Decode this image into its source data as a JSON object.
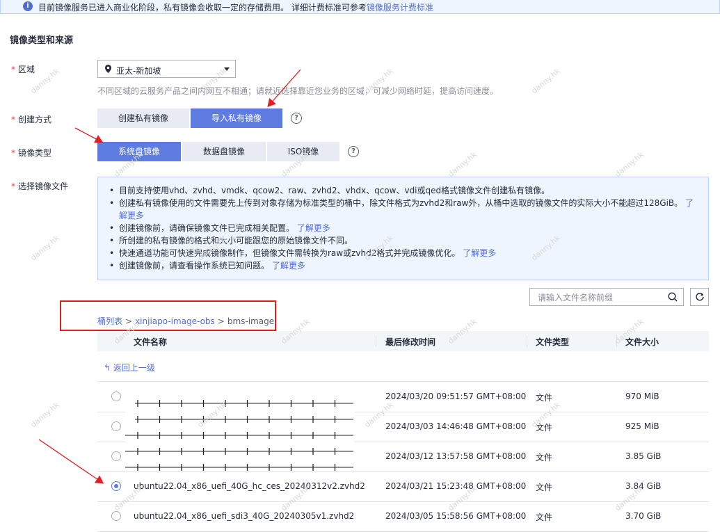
{
  "banner": {
    "text": "目前镜像服务已进入商业化阶段，私有镜像会收取一定的存储费用。 详细计费标准可参考",
    "link": "镜像服务计费标准"
  },
  "section_title": "镜像类型和来源",
  "region": {
    "label": "区域",
    "value": "亚太-新加坡",
    "hint": "不同区域的云服务产品之间内网互不相通；请就近选择靠近您业务的区域，可减少网络时延，提高访问速度。"
  },
  "create_method": {
    "label": "创建方式",
    "options": [
      "创建私有镜像",
      "导入私有镜像"
    ],
    "selected": "导入私有镜像"
  },
  "image_type": {
    "label": "镜像类型",
    "options": [
      "系统盘镜像",
      "数据盘镜像",
      "ISO镜像"
    ],
    "selected": "系统盘镜像"
  },
  "select_file": {
    "label": "选择镜像文件"
  },
  "notice": {
    "items": [
      {
        "text": "目前支持使用vhd、zvhd、vmdk、qcow2、raw、zvhd2、vhdx、qcow、vdi或qed格式镜像文件创建私有镜像。",
        "link": ""
      },
      {
        "text": "创建私有镜像使用的文件需要先上传到对象存储为标准类型的桶中，除文件格式为zvhd2和raw外，从桶中选取的镜像文件的实际大小不能超过128GiB。",
        "link": "了解更多"
      },
      {
        "text": "创建镜像前，请确保镜像文件已完成相关配置。",
        "link": "了解更多"
      },
      {
        "text": "所创建的私有镜像的格式和大小可能跟您的原始镜像文件不同。",
        "link": ""
      },
      {
        "text": "快速通道功能可快速完成镜像制作，但镜像文件需转换为raw或zvhd2格式并完成镜像优化。",
        "link": "了解更多"
      },
      {
        "text": "创建镜像前，请查看操作系统已知问题。",
        "link": "了解更多"
      }
    ]
  },
  "search": {
    "placeholder": "请输入文件名称前缀"
  },
  "breadcrumb": {
    "root": "桶列表",
    "bucket": "xinjiapo-image-obs",
    "folder": "bms-image"
  },
  "table": {
    "headers": {
      "name": "文件名称",
      "modified": "最后修改时间",
      "type": "文件类型",
      "size": "文件大小"
    },
    "back_label": "返回上一级",
    "rows": [
      {
        "name": "",
        "modified": "2024/03/20 09:51:57 GMT+08:00",
        "type": "文件",
        "size": "970 MiB",
        "selected": false
      },
      {
        "name": "",
        "modified": "2024/03/03 14:46:48 GMT+08:00",
        "type": "文件",
        "size": "925 MiB",
        "selected": false
      },
      {
        "name": "",
        "modified": "2024/03/12 13:57:58 GMT+08:00",
        "type": "文件",
        "size": "3.85 GiB",
        "selected": false
      },
      {
        "name": "ubuntu22.04_x86_uefi_40G_hc_ces_20240312v2.zvhd2",
        "modified": "2024/03/21 15:23:48 GMT+08:00",
        "type": "文件",
        "size": "3.84 GiB",
        "selected": true
      },
      {
        "name": "ubuntu22.04_x86_uefi_sdi3_40G_20240305v1.zvhd2",
        "modified": "2024/03/05 15:58:56 GMT+08:00",
        "type": "文件",
        "size": "3.70 GiB",
        "selected": false
      }
    ]
  },
  "watermark": "danny.hk",
  "colors": {
    "accent": "#5e7ce0",
    "link": "#526ecc",
    "annotation": "#e02020",
    "required": "#e5484d"
  }
}
